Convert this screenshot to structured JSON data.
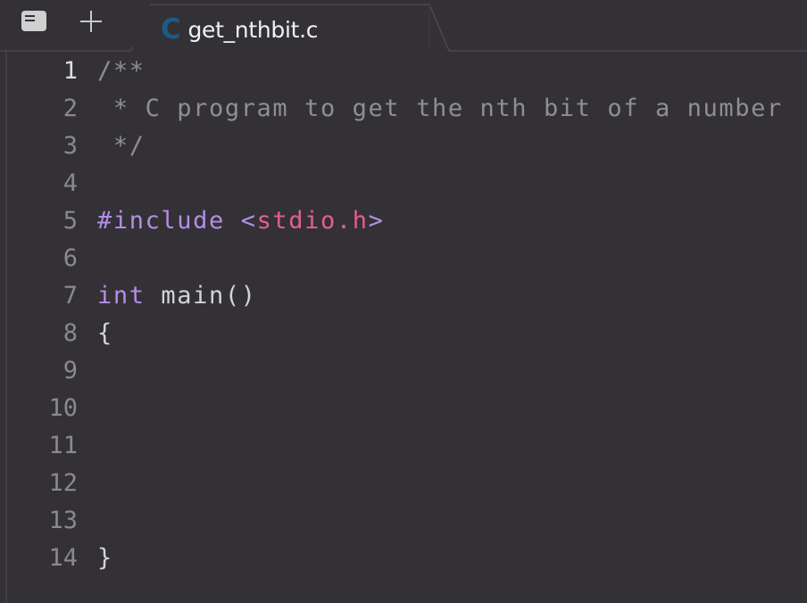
{
  "toolbar": {
    "sidebar_toggle_icon": "sidebar-icon",
    "new_tab_icon": "plus-icon"
  },
  "tabs": [
    {
      "label": "get_nthbit.c",
      "icon": "c-language-icon",
      "icon_glyph": "C",
      "active": true
    }
  ],
  "colors": {
    "background": "#333136",
    "line_number": "#8a898d",
    "comment": "#8f8f8f",
    "keyword": "#b48ee6",
    "string": "#e35f8f",
    "c_icon": "#1e5a86"
  },
  "editor": {
    "active_line": 1,
    "lines": [
      {
        "n": "1",
        "tokens": [
          {
            "t": "/**",
            "c": "cmt"
          }
        ]
      },
      {
        "n": "2",
        "tokens": [
          {
            "t": " * C program to get the nth bit of a number",
            "c": "cmt"
          }
        ]
      },
      {
        "n": "3",
        "tokens": [
          {
            "t": " */",
            "c": "cmt"
          }
        ]
      },
      {
        "n": "4",
        "tokens": []
      },
      {
        "n": "5",
        "tokens": [
          {
            "t": "#include",
            "c": "kw"
          },
          {
            "t": " ",
            "c": "plain"
          },
          {
            "t": "<",
            "c": "kw"
          },
          {
            "t": "stdio.h",
            "c": "str"
          },
          {
            "t": ">",
            "c": "kw"
          }
        ]
      },
      {
        "n": "6",
        "tokens": []
      },
      {
        "n": "7",
        "tokens": [
          {
            "t": "int",
            "c": "kw"
          },
          {
            "t": " main()",
            "c": "plain"
          }
        ]
      },
      {
        "n": "8",
        "tokens": [
          {
            "t": "{",
            "c": "plain"
          }
        ]
      },
      {
        "n": "9",
        "tokens": []
      },
      {
        "n": "10",
        "tokens": []
      },
      {
        "n": "11",
        "tokens": []
      },
      {
        "n": "12",
        "tokens": []
      },
      {
        "n": "13",
        "tokens": []
      },
      {
        "n": "14",
        "tokens": [
          {
            "t": "}",
            "c": "plain"
          }
        ]
      }
    ]
  }
}
